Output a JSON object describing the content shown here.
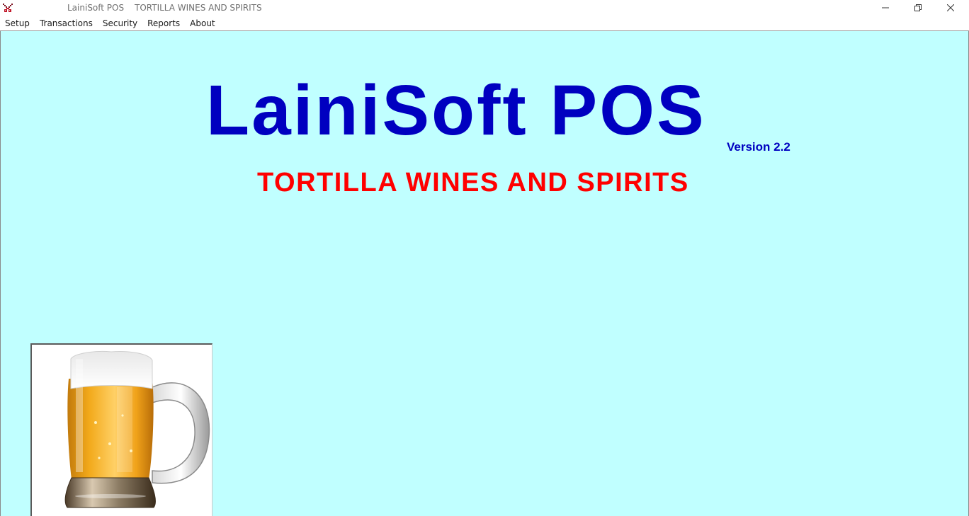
{
  "window": {
    "title_app": "LainiSoft POS",
    "title_store": "TORTILLA WINES AND SPIRITS",
    "controls": {
      "minimize_icon": "minimize-icon",
      "maximize_icon": "restore-icon",
      "close_icon": "close-icon"
    }
  },
  "menu": {
    "items": [
      "Setup",
      "Transactions",
      "Security",
      "Reports",
      "About"
    ]
  },
  "splash": {
    "title": "LainiSoft POS",
    "version": "Version 2.2",
    "store_name": "TORTILLA WINES AND SPIRITS",
    "image_icon": "beer-mug-icon"
  },
  "colors": {
    "background": "#c0ffff",
    "title": "#0000c0",
    "version": "#0000c0",
    "store_name": "#ff0000"
  }
}
